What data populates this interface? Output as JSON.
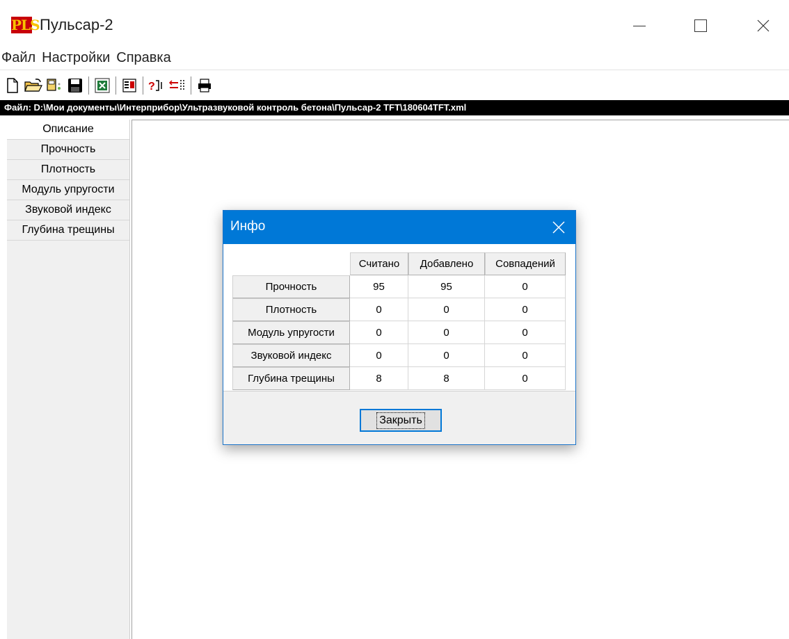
{
  "window": {
    "logo_text": "PLS",
    "title": "Пульсар-2"
  },
  "menu": [
    "Файл",
    "Настройки",
    "Справка"
  ],
  "toolbar": {
    "icons": [
      "new-file-icon",
      "open-folder-icon",
      "device-transfer-icon",
      "save-icon",
      "excel-export-icon",
      "data-view-icon",
      "search-icon",
      "compare-icon",
      "print-icon"
    ]
  },
  "path": "Файл: D:\\Мои документы\\Интерприбор\\Ультразвуковой контроль бетона\\Пульсар-2 TFT\\180604TFT.xml",
  "sidebar": {
    "tabs": [
      "Описание",
      "Прочность",
      "Плотность",
      "Модуль упругости",
      "Звуковой индекс",
      "Глубина трещины"
    ],
    "active_index": 0
  },
  "dialog": {
    "title": "Инфо",
    "columns": [
      "Считано",
      "Добавлено",
      "Совпадений"
    ],
    "rows": [
      {
        "label": "Прочность",
        "values": [
          "95",
          "95",
          "0"
        ]
      },
      {
        "label": "Плотность",
        "values": [
          "0",
          "0",
          "0"
        ]
      },
      {
        "label": "Модуль упругости",
        "values": [
          "0",
          "0",
          "0"
        ]
      },
      {
        "label": "Звуковой индекс",
        "values": [
          "0",
          "0",
          "0"
        ]
      },
      {
        "label": "Глубина трещины",
        "values": [
          "8",
          "8",
          "0"
        ]
      }
    ],
    "close_button": "Закрыть"
  },
  "colors": {
    "accent": "#0078d7",
    "path_bar": "#000000",
    "logo_bg": "#c8000a",
    "logo_fg": "#f7c300"
  }
}
